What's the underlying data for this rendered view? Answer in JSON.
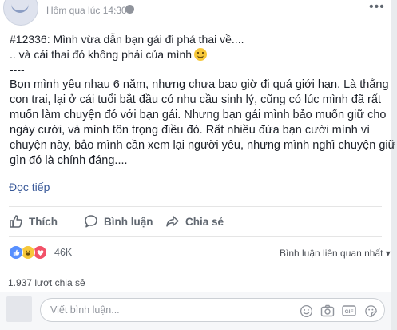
{
  "post": {
    "timestamp": "Hôm qua lúc 14:30",
    "separator": "·",
    "lines": [
      "#12336: Mình vừa dẫn bạn gái đi phá thai về....",
      ".. và cái thai đó không phải của mình",
      "----"
    ],
    "body_lines": [
      "Bọn mình yêu nhau 6 năm, nhưng chưa bao giờ đi quá giới hạn. Là thằng",
      "con trai, lại ở cái tuổi bắt đầu có nhu cầu sinh lý, cũng có lúc mình đã rất",
      "muốn làm chuyện đó với bạn gái. Nhưng bạn gái mình bảo muốn giữ cho",
      "ngày cưới, và mình tôn trọng điều đó. Rất nhiều đứa bạn cười mình vì",
      "chuyện này, bảo mình cần xem lại người yêu, nhưng mình nghĩ chuyện giữ",
      "gìn đó là chính đáng...."
    ],
    "read_more": "Đọc tiếp"
  },
  "actions": {
    "like": "Thích",
    "comment": "Bình luận",
    "share": "Chia sẻ"
  },
  "stats": {
    "reaction_count": "46K",
    "sort_label": "Bình luận liên quan nhất",
    "sort_caret": "▾",
    "shares": "1.937 lượt chia sẻ"
  },
  "composer": {
    "placeholder": "Viết bình luận..."
  },
  "colors": {
    "link": "#385898",
    "like_reaction": "#5890ff",
    "love_reaction": "#f25268",
    "haha_reaction": "#f7c83a"
  }
}
